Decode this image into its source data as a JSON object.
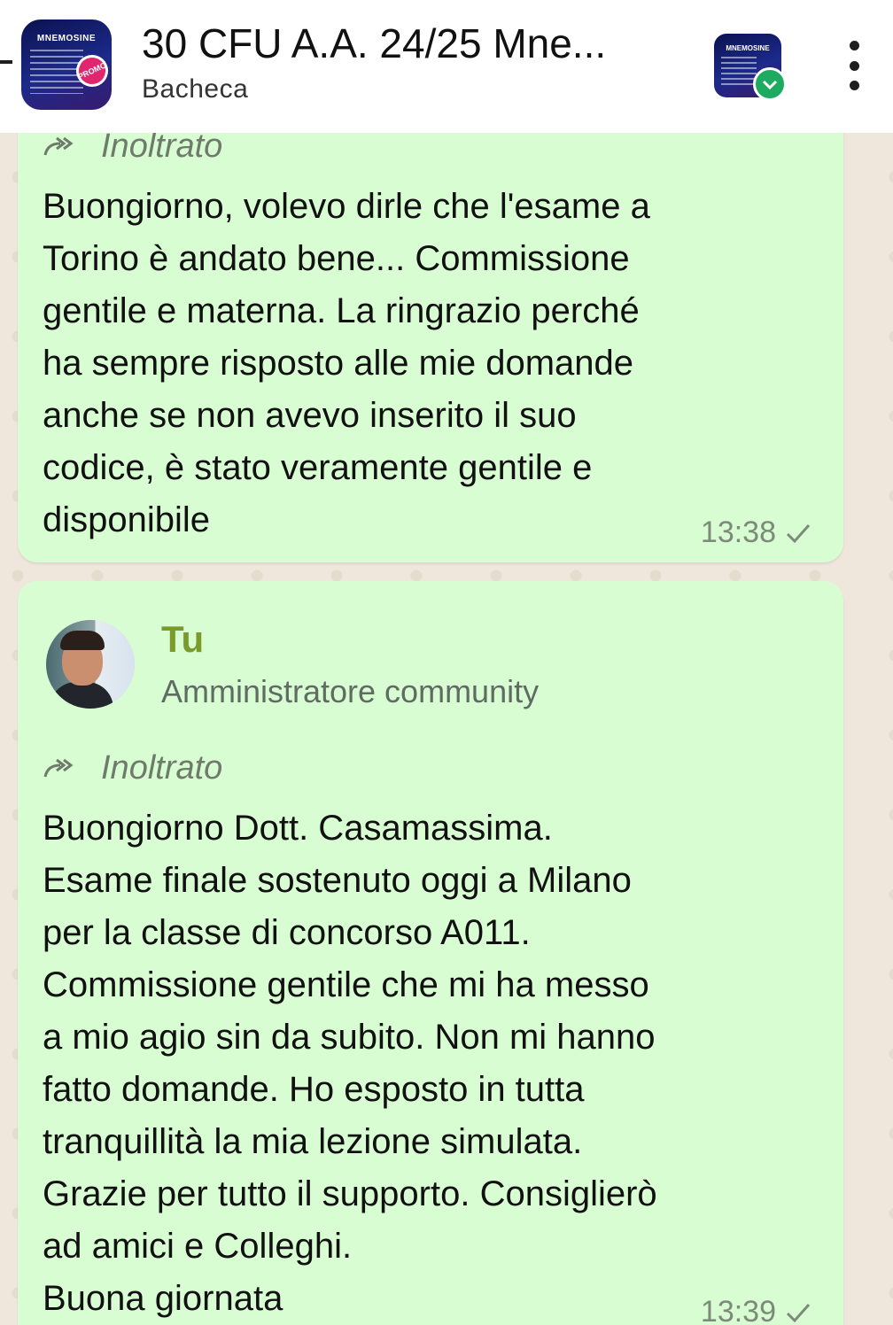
{
  "header": {
    "title": "30 CFU A.A. 24/25 Mne...",
    "subtitle": "Bacheca",
    "avatar_logo_text": "MNEMOSINE",
    "avatar_badge_text": "PROMO",
    "kebab_icon": "more-vertical-icon",
    "verified_color": "#1daa61"
  },
  "messages": [
    {
      "forwarded_label": "Inoltrato",
      "text": "Buongiorno, volevo dirle che l'esame a\nTorino è andato bene... Commissione\ngentile e materna. La ringrazio perché\nha sempre risposto alle mie domande\nanche se non avevo inserito il suo\ncodice, è stato veramente gentile e\ndisponibile",
      "time": "13:38",
      "status_icon": "check-icon"
    },
    {
      "sender_name": "Tu",
      "sender_role": "Amministratore community",
      "forwarded_label": "Inoltrato",
      "text": "Buongiorno Dott. Casamassima.\nEsame finale sostenuto oggi a Milano\nper la classe di concorso A011.\nCommissione gentile che mi ha messo\na mio agio sin da subito. Non mi hanno\nfatto domande. Ho esposto in tutta\ntranquillità la mia lezione simulata.\nGrazie per tutto il supporto. Consiglierò\nad amici e Colleghi.\nBuona giornata",
      "time": "13:39",
      "status_icon": "check-icon"
    }
  ],
  "colors": {
    "bubble": "#d9fdd3",
    "background": "#efe7dc",
    "sender_name": "#7a9a2a"
  }
}
